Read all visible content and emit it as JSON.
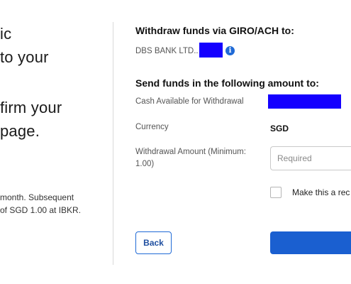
{
  "left_panel": {
    "heading_lines": [
      "ic",
      "to your",
      "firm your",
      "page."
    ],
    "note_lines": [
      "month. Subsequent",
      "of SGD 1.00 at IBKR."
    ]
  },
  "withdraw": {
    "heading": "Withdraw funds via GIRO/ACH to:",
    "bank_name": "DBS BANK LTD..",
    "info_icon": "info-icon"
  },
  "send_funds": {
    "heading": "Send funds in the following amount to:",
    "cash_label": "Cash Available for Withdrawal",
    "currency_label": "Currency",
    "currency_value": "SGD",
    "amount_label_line1": "Withdrawal Amount (Minimum:",
    "amount_label_line2": "1.00)",
    "amount_placeholder": "Required",
    "amount_value": "",
    "recurring_label": "Make this a rec"
  },
  "buttons": {
    "back_label": "Back",
    "primary_label": ""
  },
  "colors": {
    "accent": "#1a5fd0",
    "redaction": "#1400ff",
    "divider": "#d9d9d9"
  }
}
